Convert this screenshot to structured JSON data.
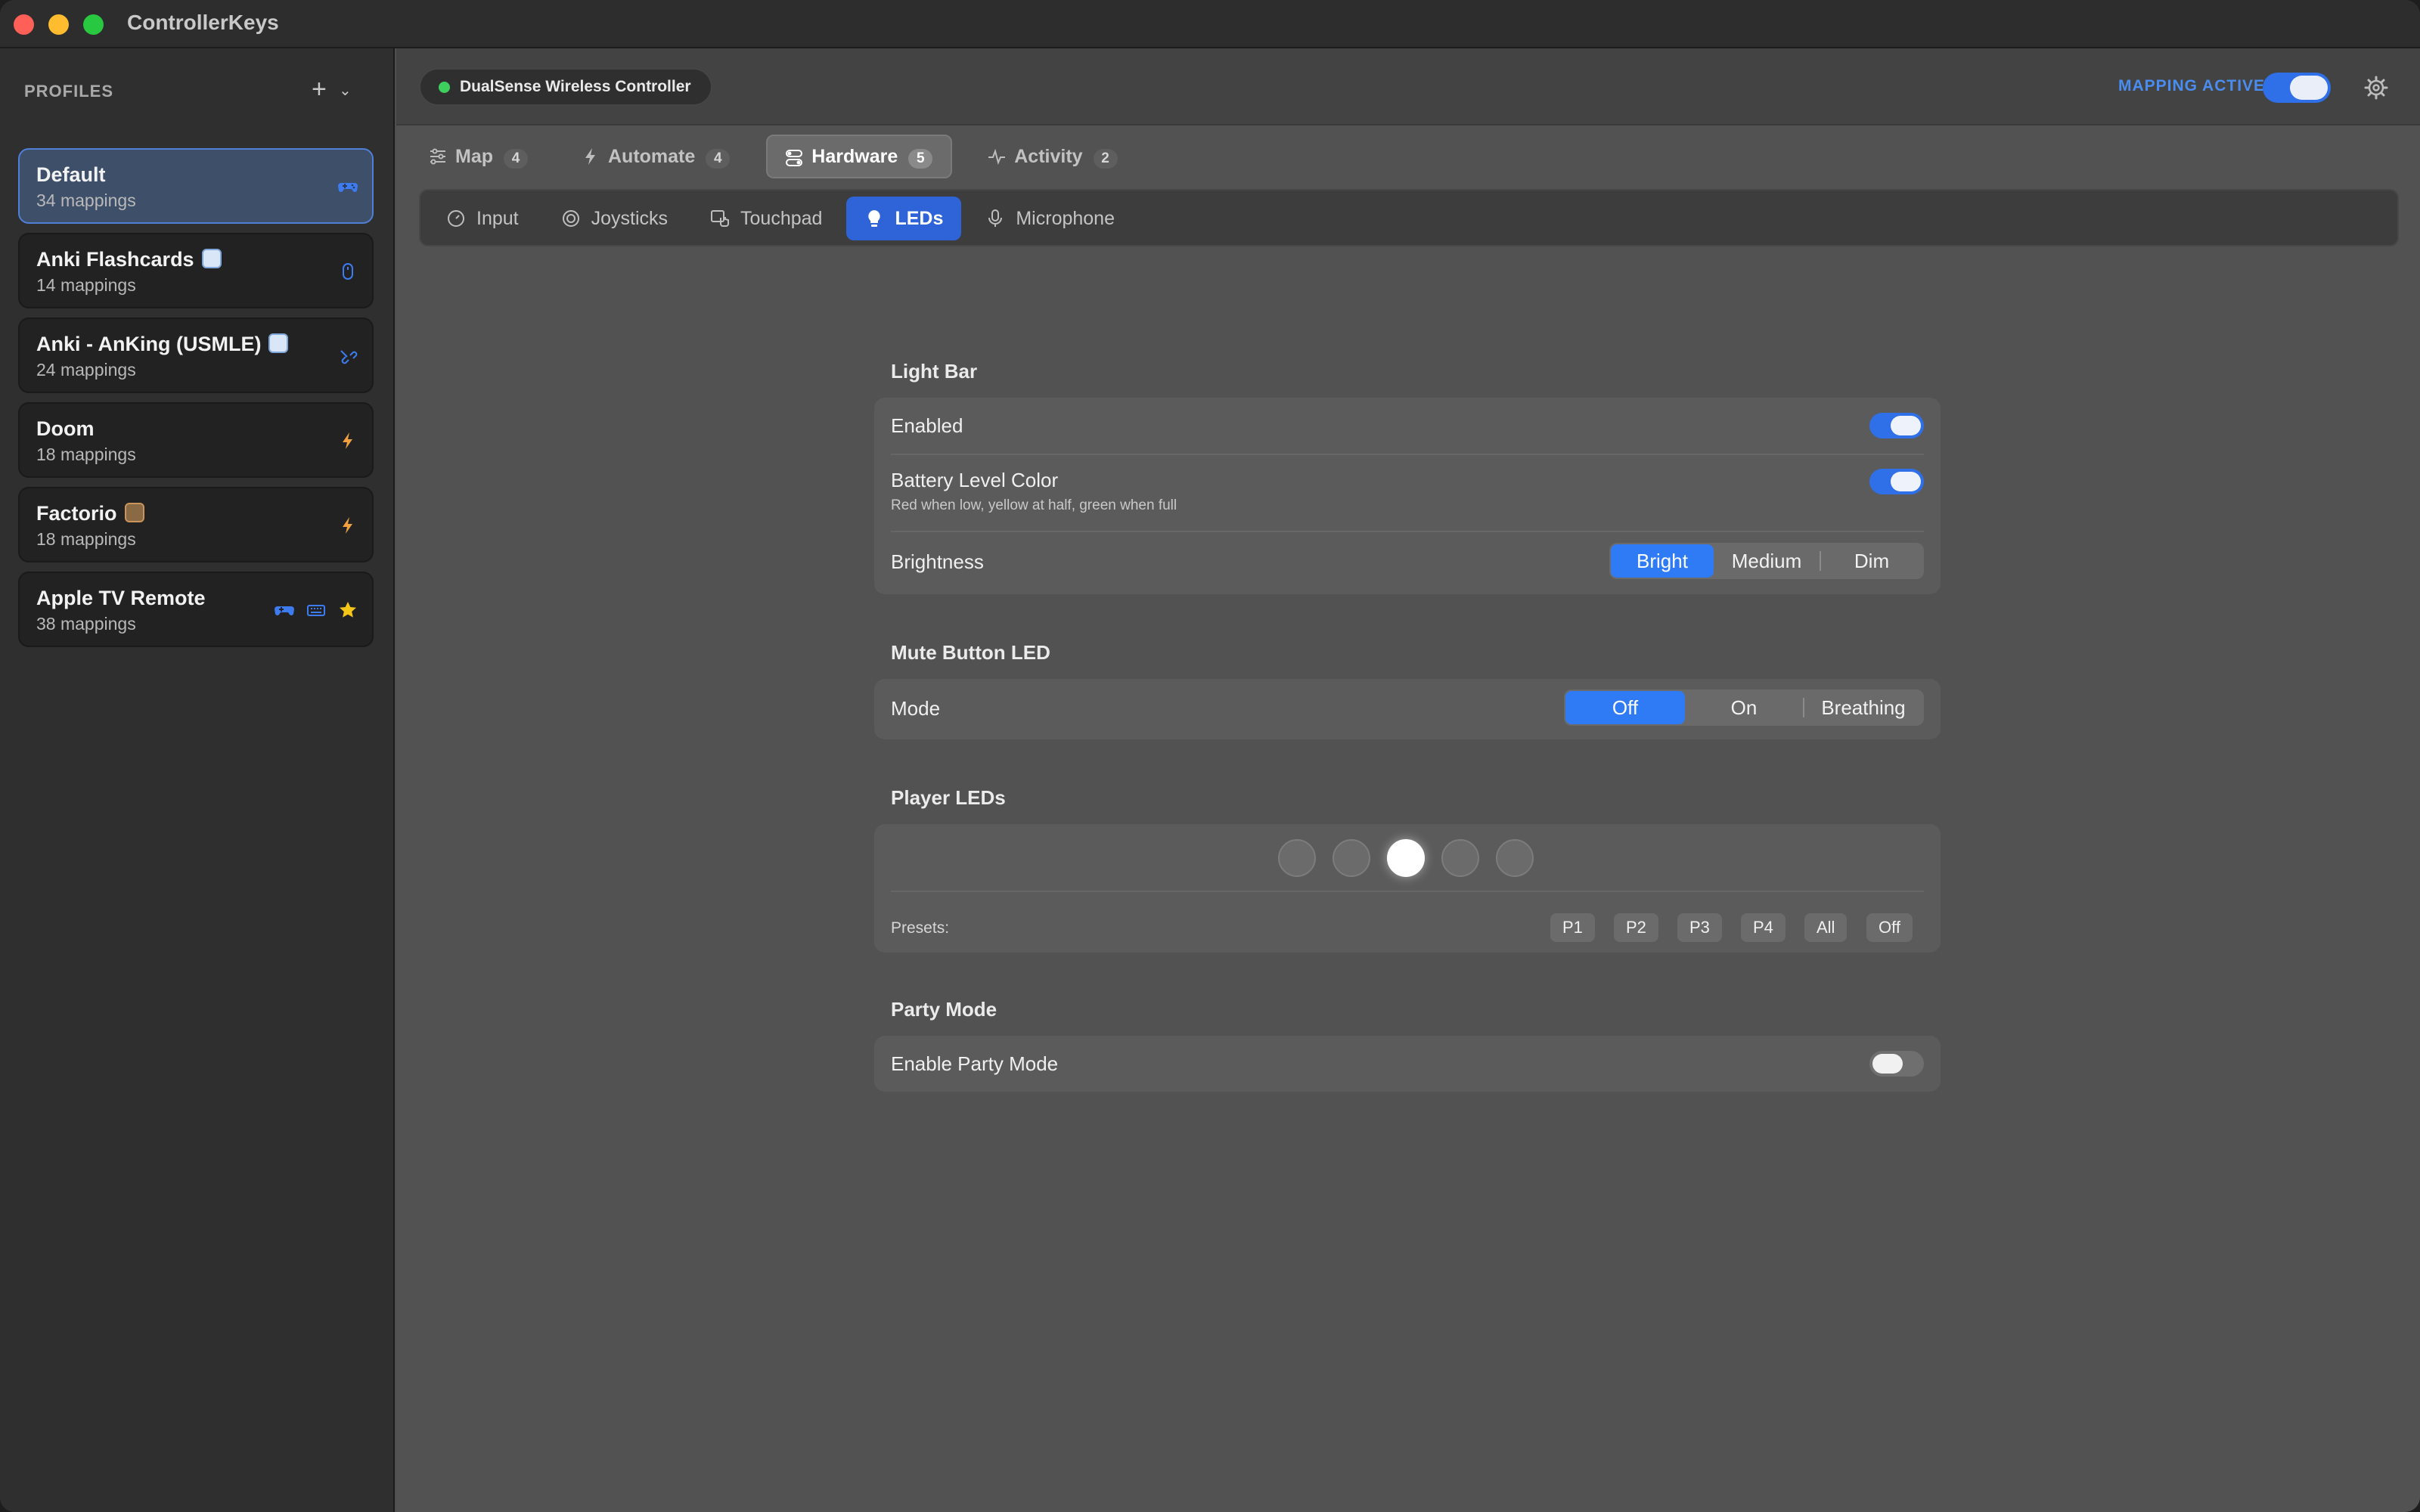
{
  "app": {
    "title": "ControllerKeys"
  },
  "sidebar": {
    "header": "PROFILES",
    "add_label": "+",
    "profiles": [
      {
        "name": "Default",
        "count": "34 mappings",
        "selected": true,
        "icons": [
          "gamepad-icon"
        ]
      },
      {
        "name": "Anki Flashcards",
        "count": "14 mappings",
        "icons": [
          "mouse-icon"
        ],
        "emoji": "flashcard-app-icon"
      },
      {
        "name": "Anki - AnKing (USMLE)",
        "count": "24 mappings",
        "icons": [
          "link-icon"
        ],
        "emoji": "flashcard-app-icon"
      },
      {
        "name": "Doom",
        "count": "18 mappings",
        "icons": [
          "bolt-icon"
        ]
      },
      {
        "name": "Factorio",
        "count": "18 mappings",
        "icons": [
          "bolt-icon"
        ],
        "emoji": "factorio-app-icon"
      },
      {
        "name": "Apple TV Remote",
        "count": "38 mappings",
        "icons": [
          "gamepad-icon",
          "keyboard-icon",
          "star-icon"
        ]
      }
    ]
  },
  "topbar": {
    "controller_name": "DualSense Wireless Controller",
    "controller_status_color": "#3ecf5f",
    "mapping_label": "MAPPING ACTIVE",
    "mapping_active": true
  },
  "tabs": [
    {
      "label": "Map",
      "badge": "4",
      "icon": "sliders-icon"
    },
    {
      "label": "Automate",
      "badge": "4",
      "icon": "bolt-icon"
    },
    {
      "label": "Hardware",
      "badge": "5",
      "icon": "toggles-icon",
      "active": true
    },
    {
      "label": "Activity",
      "badge": "2",
      "icon": "pulse-icon"
    }
  ],
  "subtabs": [
    {
      "label": "Input",
      "icon": "gauge-icon"
    },
    {
      "label": "Joysticks",
      "icon": "joystick-icon"
    },
    {
      "label": "Touchpad",
      "icon": "touchpad-icon"
    },
    {
      "label": "LEDs",
      "icon": "bulb-icon",
      "active": true
    },
    {
      "label": "Microphone",
      "icon": "microphone-icon"
    }
  ],
  "light_bar": {
    "title": "Light Bar",
    "enabled_label": "Enabled",
    "enabled": true,
    "battery_label": "Battery Level Color",
    "battery_sub": "Red when low, yellow at half, green when full",
    "battery_enabled": true,
    "brightness_label": "Brightness",
    "brightness_options": [
      "Bright",
      "Medium",
      "Dim"
    ],
    "brightness_selected": "Bright"
  },
  "mute_led": {
    "title": "Mute Button LED",
    "mode_label": "Mode",
    "mode_options": [
      "Off",
      "On",
      "Breathing"
    ],
    "mode_selected": "Off"
  },
  "player_leds": {
    "title": "Player LEDs",
    "leds": [
      false,
      false,
      true,
      false,
      false
    ],
    "presets_label": "Presets:",
    "presets": [
      "P1",
      "P2",
      "P3",
      "P4",
      "All",
      "Off"
    ]
  },
  "party_mode": {
    "title": "Party Mode",
    "enable_label": "Enable Party Mode",
    "enabled": false
  },
  "colors": {
    "accent": "#2f6fe8",
    "selected_card": "#3e4f6a"
  }
}
